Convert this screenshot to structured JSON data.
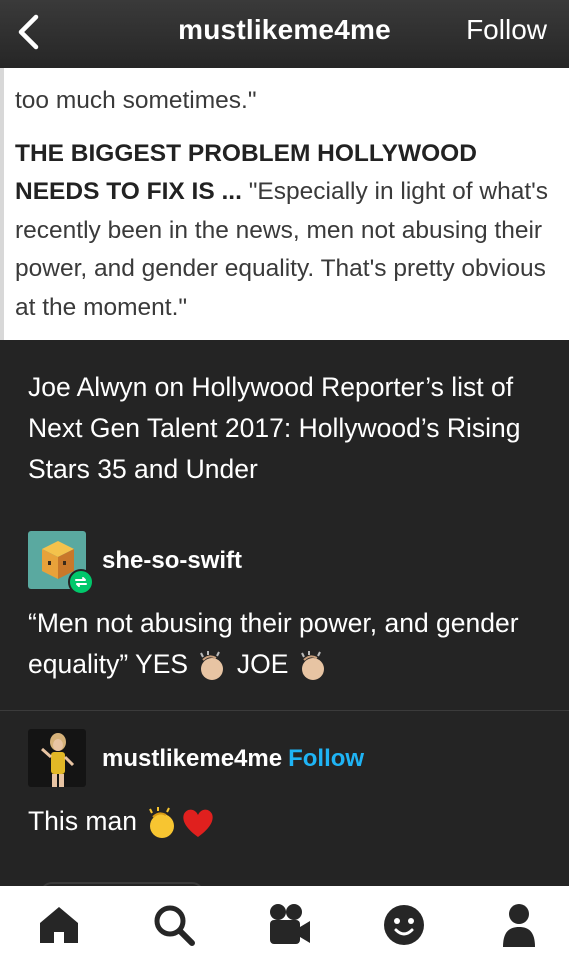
{
  "header": {
    "title": "mustlikeme4me",
    "follow_label": "Follow"
  },
  "article": {
    "cut_line": "... ... ... ... ... ... ... ...",
    "line1": "too much sometimes.\"",
    "bold_lead": "THE BIGGEST PROBLEM HOLLYWOOD NEEDS TO FIX IS ...",
    "quote": " \"Especially in light of what's recently been in the news, men not abusing their power, and gender equality. That's pretty obvious at the moment.\""
  },
  "caption": "Joe Alwyn on Hollywood Reporter’s list of Next Gen Talent 2017: Hollywood’s Rising Stars 35 and Under",
  "reblogs": [
    {
      "username": "she-so-swift",
      "text_a": "“Men not abusing their power, and gender equality” YES",
      "text_b": "JOE"
    },
    {
      "username": "mustlikeme4me",
      "follow_label": "Follow",
      "text": "This man"
    }
  ],
  "icons": [
    "back-chevron-icon",
    "reblog-icon",
    "clap-emoji",
    "heart-emoji",
    "home-icon",
    "search-icon",
    "video-icon",
    "smiley-icon",
    "account-icon"
  ],
  "colors": {
    "accent": "#1fb4f5",
    "reblog_badge": "#00c86b",
    "background": "#242424"
  }
}
